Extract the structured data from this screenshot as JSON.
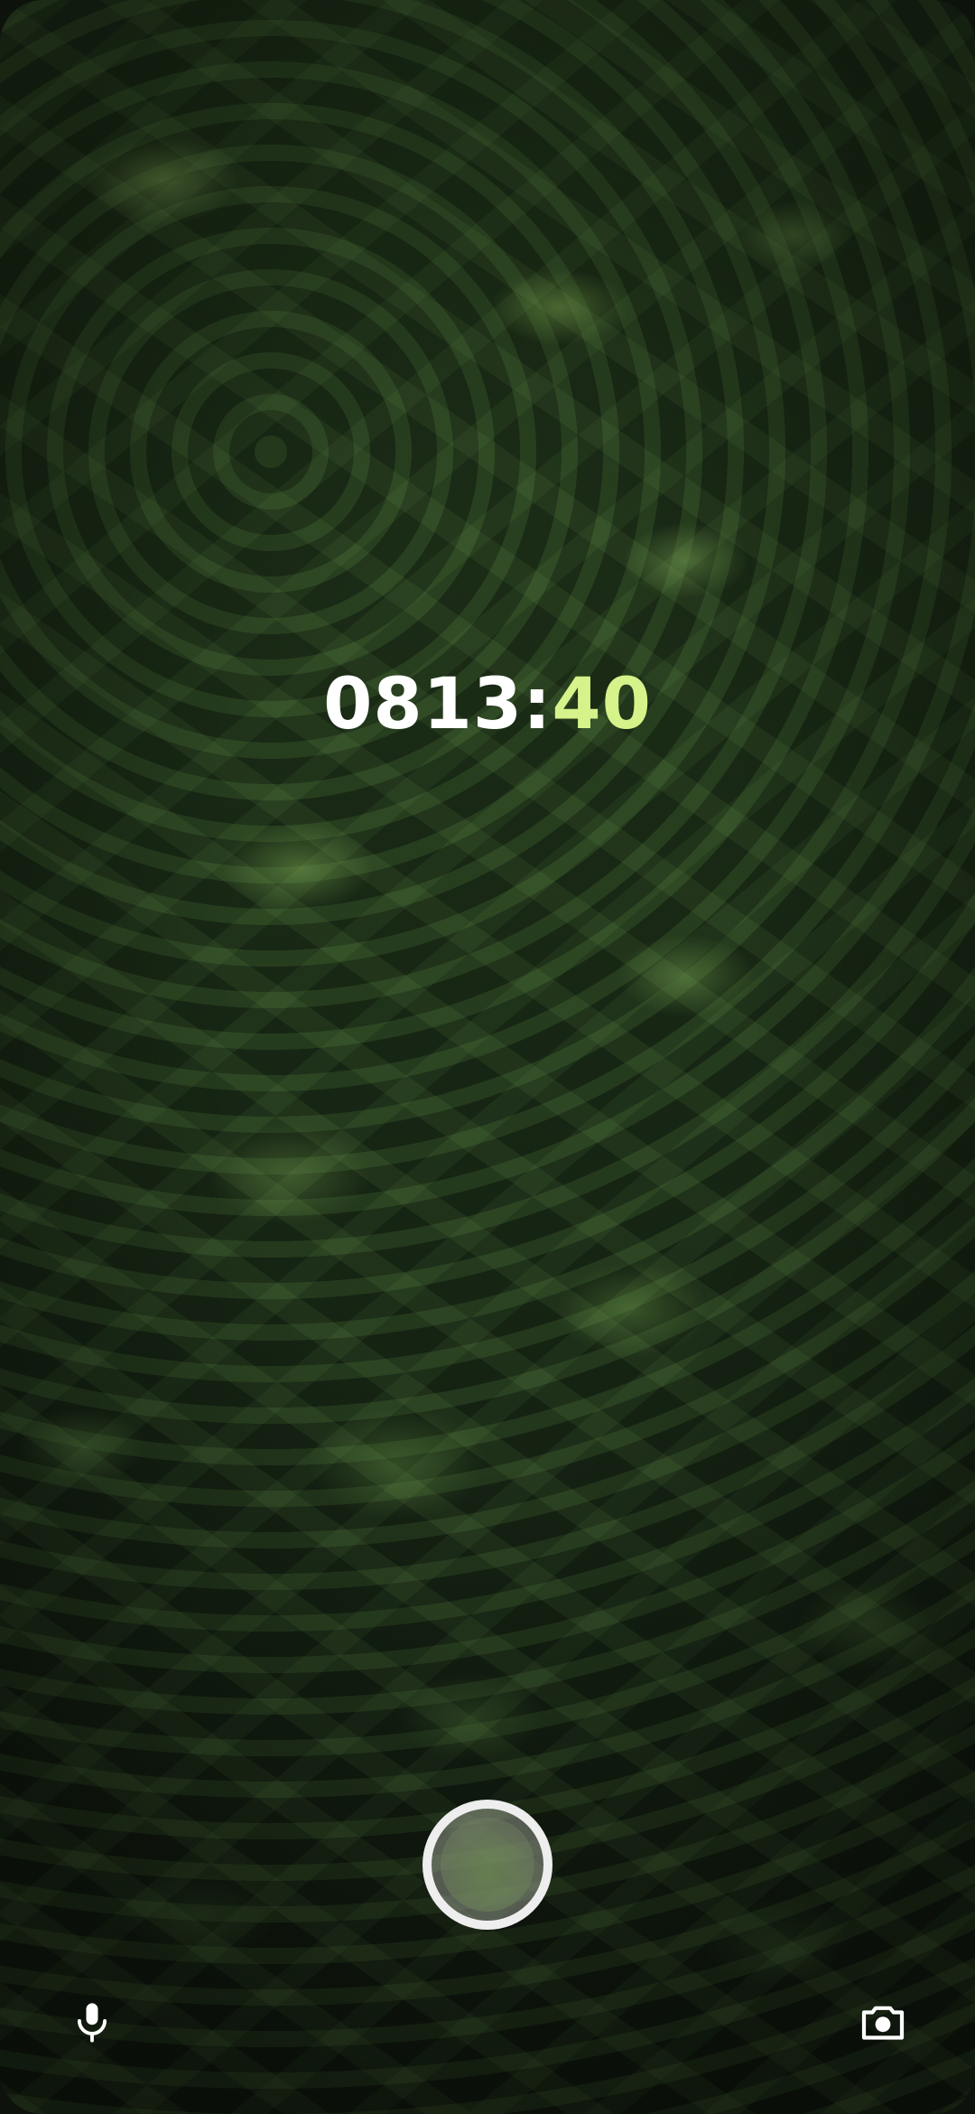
{
  "timer": {
    "main": "0813",
    "separator": ":",
    "seconds": "40"
  },
  "controls": {
    "left_icon": "microphone-icon",
    "shutter": "shutter-button",
    "right_icon": "camera-icon"
  },
  "colors": {
    "timer_main": "#ffffff",
    "timer_seconds": "#d6f28a",
    "shutter_ring": "#eeeeee"
  }
}
